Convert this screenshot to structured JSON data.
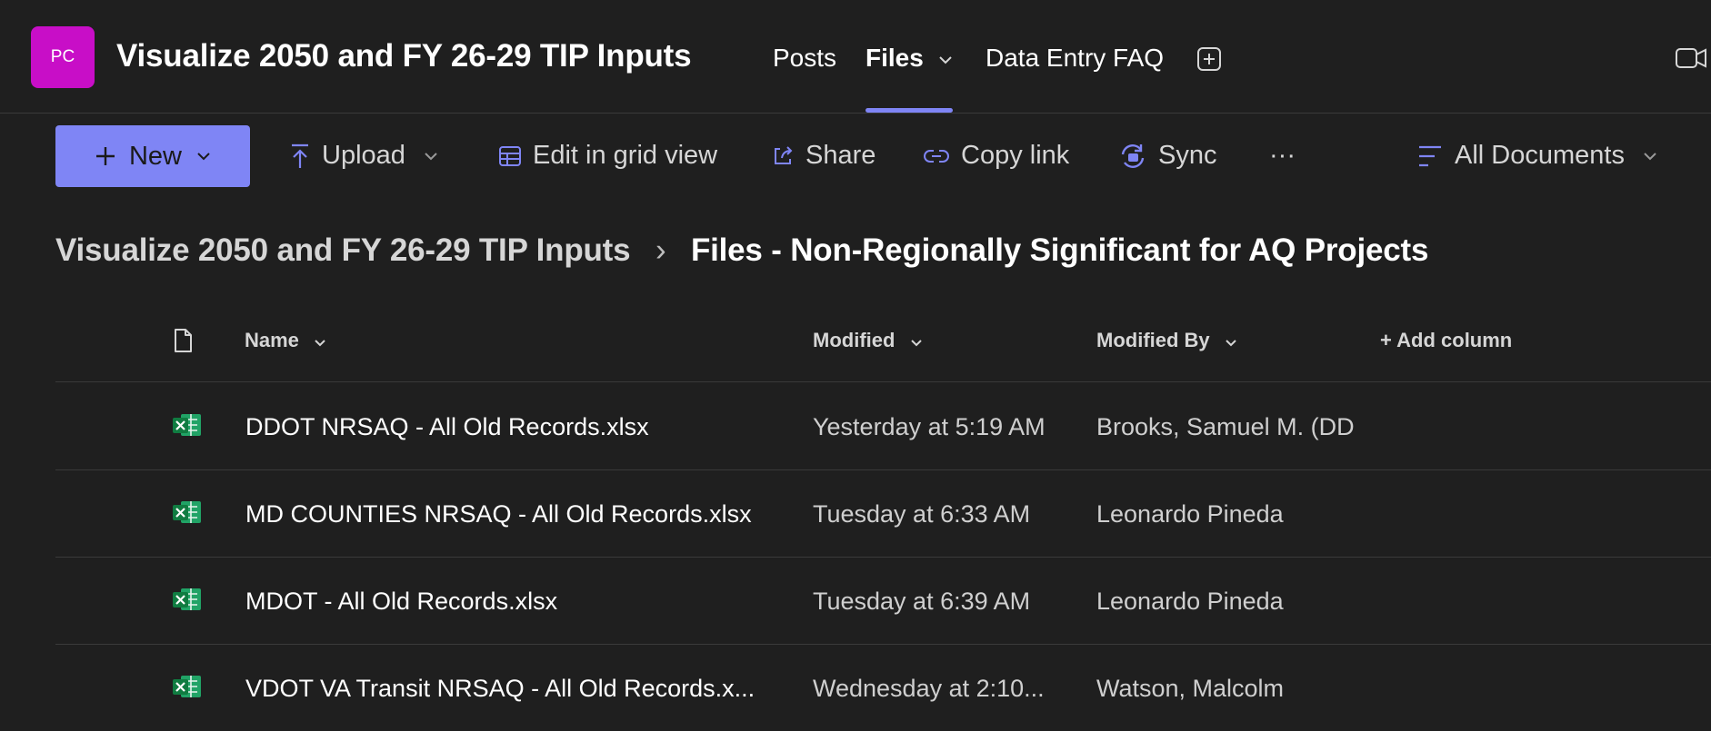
{
  "header": {
    "avatar_initials": "PC",
    "avatar_color": "#c80ec7",
    "channel_title": "Visualize 2050 and FY 26-29 TIP Inputs",
    "tabs": [
      {
        "label": "Posts"
      },
      {
        "label": "Files",
        "active": true
      },
      {
        "label": "Data Entry FAQ"
      }
    ],
    "accent_color": "#7f85f5"
  },
  "toolbar": {
    "new_label": "New",
    "upload_label": "Upload",
    "edit_grid_label": "Edit in grid view",
    "share_label": "Share",
    "copy_link_label": "Copy link",
    "sync_label": "Sync",
    "more_label": "···",
    "view_label": "All Documents"
  },
  "breadcrumb": {
    "parent": "Visualize 2050 and FY 26-29 TIP Inputs",
    "separator": "›",
    "current": "Files - Non-Regionally Significant for AQ Projects"
  },
  "columns": {
    "name": "Name",
    "modified": "Modified",
    "modified_by": "Modified By",
    "add_column": "+ Add column"
  },
  "files": [
    {
      "name": "DDOT NRSAQ - All Old Records.xlsx",
      "modified": "Yesterday at 5:19 AM",
      "modified_by": "Brooks, Samuel M. (DD"
    },
    {
      "name": "MD COUNTIES NRSAQ - All Old Records.xlsx",
      "modified": "Tuesday at 6:33 AM",
      "modified_by": "Leonardo Pineda"
    },
    {
      "name": "MDOT - All Old Records.xlsx",
      "modified": "Tuesday at 6:39 AM",
      "modified_by": "Leonardo Pineda"
    },
    {
      "name": "VDOT VA Transit NRSAQ - All Old Records.x...",
      "modified": "Wednesday at 2:10...",
      "modified_by": "Watson, Malcolm"
    }
  ]
}
